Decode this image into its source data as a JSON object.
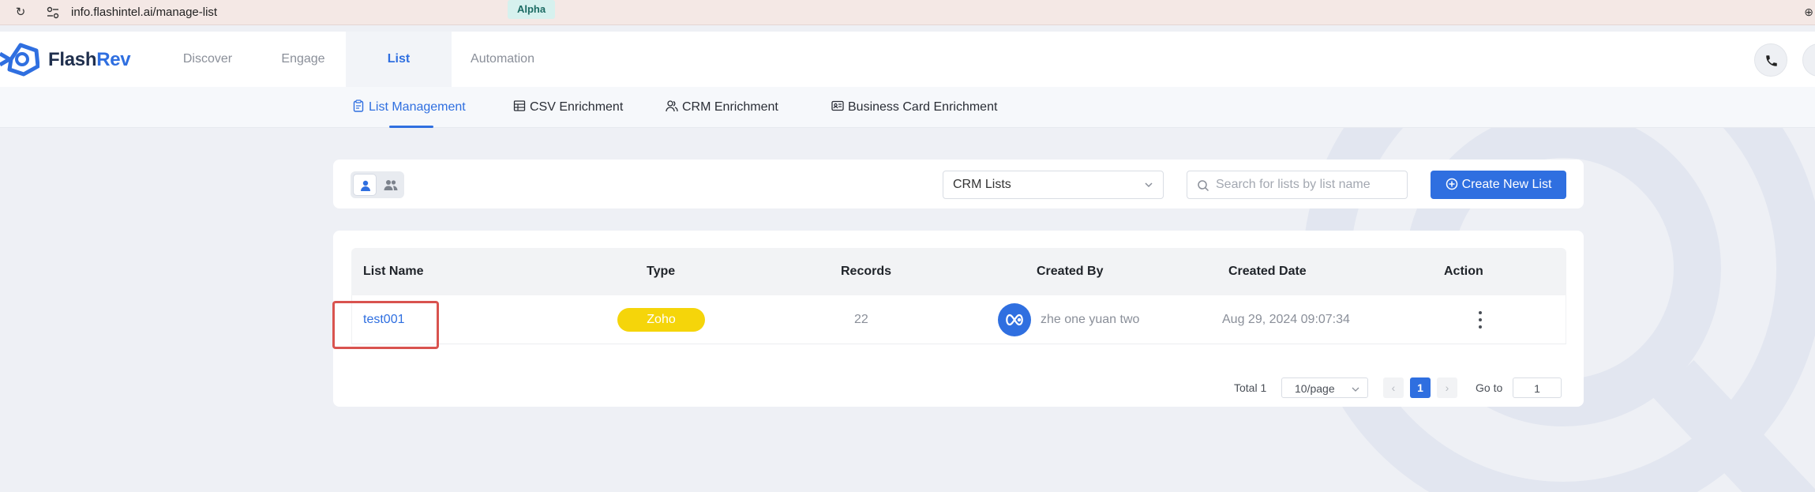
{
  "browser": {
    "url": "info.flashintel.ai/manage-list"
  },
  "brand": {
    "name_part1": "Flash",
    "name_part2": "Rev",
    "accent_color": "#2f6fe0"
  },
  "topnav": {
    "items": [
      {
        "label": "Discover",
        "active": false
      },
      {
        "label": "Engage",
        "active": false
      },
      {
        "label": "List",
        "active": true
      },
      {
        "label": "Automation",
        "active": false
      }
    ],
    "automation_badge": "Alpha",
    "icons": [
      "phone-icon",
      "user-avatar"
    ]
  },
  "subnav": {
    "tabs": [
      {
        "label": "List Management",
        "icon": "clipboard-icon",
        "active": true
      },
      {
        "label": "CSV Enrichment",
        "icon": "table-icon",
        "active": false
      },
      {
        "label": "CRM Enrichment",
        "icon": "users-icon",
        "active": false
      },
      {
        "label": "Business Card Enrichment",
        "icon": "id-card-icon",
        "active": false
      }
    ]
  },
  "filters": {
    "view_toggle": [
      "person-icon",
      "people-icon"
    ],
    "list_source": "CRM Lists",
    "search_placeholder": "Search for lists by list name",
    "create_button": "Create New List"
  },
  "table": {
    "columns": [
      "List Name",
      "Type",
      "Records",
      "Created By",
      "Created Date",
      "Action"
    ],
    "rows": [
      {
        "list_name": "test001",
        "type": "Zoho",
        "type_color": "#f5d50a",
        "records": "22",
        "created_by": "zhe one yuan two",
        "created_date": "Aug 29, 2024 09:07:34"
      }
    ]
  },
  "pagination": {
    "total": "Total 1",
    "page_size": "10/page",
    "current_page": "1",
    "goto_label": "Go to",
    "goto_value": "1"
  }
}
